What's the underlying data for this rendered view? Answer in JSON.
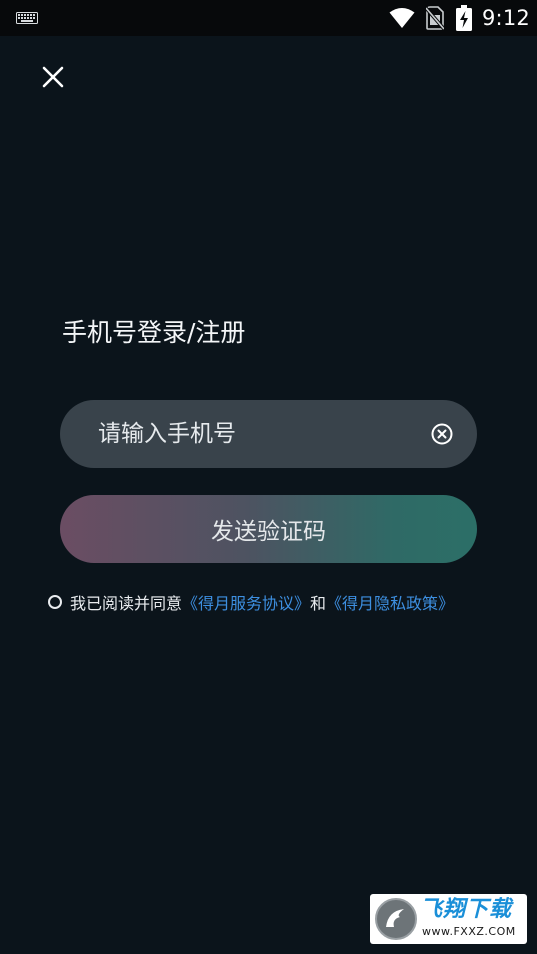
{
  "status_bar": {
    "time": "9:12",
    "icons": [
      "keyboard-icon",
      "wifi-icon",
      "no-sim-icon",
      "battery-charging-icon"
    ]
  },
  "header": {
    "close_icon": "close-icon"
  },
  "login": {
    "title": "手机号登录/注册",
    "phone_placeholder": "请输入手机号",
    "phone_value": "",
    "clear_icon": "clear-circle-icon",
    "send_code_label": "发送验证码"
  },
  "agreement": {
    "prefix": "我已阅读并同意",
    "service_link": "《得月服务协议》",
    "conjunction": "和",
    "privacy_link": "《得月隐私政策》"
  },
  "watermark": {
    "title": "飞翔下载",
    "url": "www.FXXZ.COM"
  },
  "colors": {
    "background": "#0b141b",
    "input_bg": "#39434b",
    "link": "#3d8fe0",
    "button_gradient_start": "#6b4d63",
    "button_gradient_end": "#2c6f67"
  }
}
